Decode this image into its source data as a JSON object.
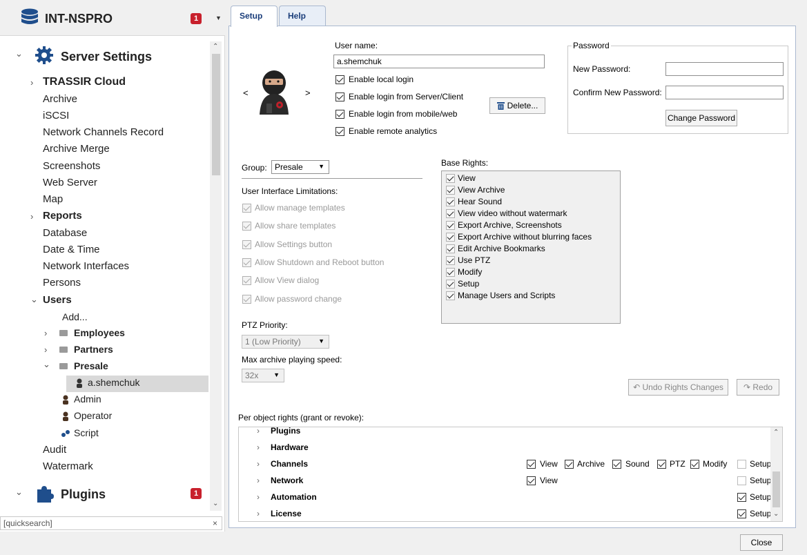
{
  "sidebar": {
    "server_name": "INT-NSPRO",
    "badge": "1",
    "items": {
      "server_settings": "Server Settings",
      "trassir_cloud": "TRASSIR Cloud",
      "archive": "Archive",
      "iscsi": "iSCSI",
      "network_channels_record": "Network Channels Record",
      "archive_merge": "Archive Merge",
      "screenshots": "Screenshots",
      "web_server": "Web Server",
      "map": "Map",
      "reports": "Reports",
      "database": "Database",
      "date_time": "Date & Time",
      "network_interfaces": "Network Interfaces",
      "persons": "Persons",
      "users": "Users",
      "add": "Add...",
      "employees": "Employees",
      "partners": "Partners",
      "presale": "Presale",
      "a_shemchuk": "a.shemchuk",
      "admin": "Admin",
      "operator": "Operator",
      "script": "Script",
      "audit": "Audit",
      "watermark": "Watermark",
      "plugins": "Plugins",
      "plugins_badge": "1"
    },
    "quicksearch_placeholder": "[quicksearch]"
  },
  "tabs": [
    "Setup",
    "Help"
  ],
  "user": {
    "username_label": "User name:",
    "username_value": "a.shemchuk",
    "enable_local_login": "Enable local login",
    "enable_login_server_client": "Enable login from Server/Client",
    "enable_login_mobile_web": "Enable login from mobile/web",
    "enable_remote_analytics": "Enable remote analytics",
    "delete_button": "Delete...",
    "prev_arrow": "<",
    "next_arrow": ">"
  },
  "password": {
    "group_title": "Password",
    "new_password_label": "New Password:",
    "confirm_password_label": "Confirm New Password:",
    "change_button": "Change Password"
  },
  "group": {
    "label": "Group:",
    "value": "Presale"
  },
  "ui_limitations": {
    "title": "User Interface Limitations:",
    "items": [
      "Allow manage templates",
      "Allow share templates",
      "Allow Settings button",
      "Allow Shutdown and Reboot button",
      "Allow View dialog",
      "Allow password change"
    ]
  },
  "ptz": {
    "label": "PTZ Priority:",
    "value": "1 (Low Priority)"
  },
  "speed": {
    "label": "Max archive playing speed:",
    "value": "32x"
  },
  "base_rights": {
    "title": "Base Rights:",
    "items": [
      "View",
      "View Archive",
      "Hear Sound",
      "View video without watermark",
      "Export Archive, Screenshots",
      "Export Archive without blurring faces",
      "Edit Archive Bookmarks",
      "Use PTZ",
      "Modify",
      "Setup",
      "Manage Users and Scripts"
    ]
  },
  "undo_button": "Undo Rights Changes",
  "redo_button": "Redo",
  "per_object": {
    "title": "Per object rights (grant or revoke):",
    "rows": [
      {
        "name": "Plugins"
      },
      {
        "name": "Hardware"
      },
      {
        "name": "Channels",
        "view": "View",
        "archive": "Archive",
        "sound": "Sound",
        "ptz": "PTZ",
        "modify": "Modify",
        "setup": "Setup"
      },
      {
        "name": "Network",
        "view": "View",
        "setup": "Setup"
      },
      {
        "name": "Automation",
        "setup": "Setup"
      },
      {
        "name": "License",
        "setup": "Setup"
      }
    ]
  },
  "close_button": "Close"
}
